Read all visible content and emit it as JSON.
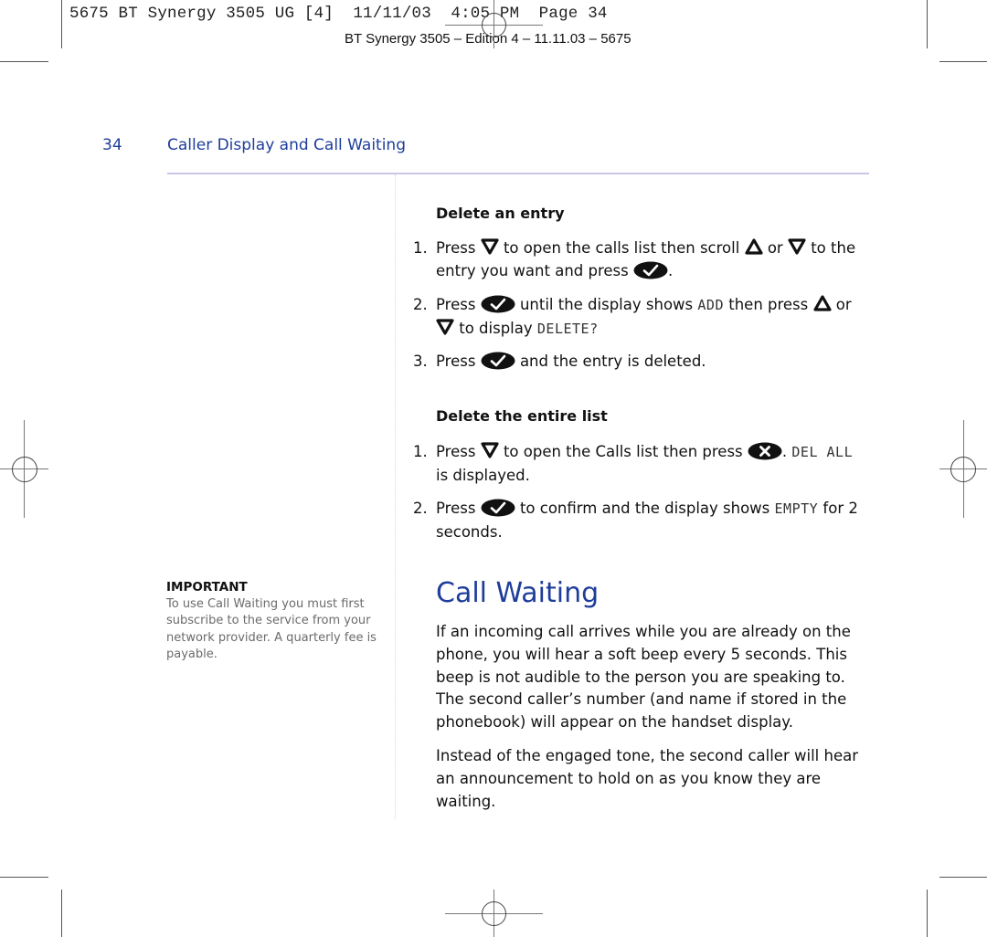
{
  "slug": {
    "text": "5675 BT Synergy 3505 UG [4]  11/11/03  4:05 PM  Page 34",
    "edition": "BT Synergy 3505 – Edition 4 – 11.11.03 – 5675"
  },
  "header": {
    "page_number": "34",
    "chapter_title": "Caller Display and Call Waiting"
  },
  "icons": {
    "down": "down-arrow-key-icon",
    "up": "up-arrow-key-icon",
    "ok": "ok-check-key-icon",
    "cancel": "cancel-x-key-icon"
  },
  "delete_entry": {
    "heading": "Delete an entry",
    "steps": [
      {
        "num": "1.",
        "t1": "Press",
        "t2": "to open the calls list then scroll",
        "t3": "or",
        "t4": "to the",
        "t5": "entry you want and press",
        "t6": "."
      },
      {
        "num": "2.",
        "t1": "Press",
        "t2": "until the display shows",
        "lcd1": "ADD",
        "t3": "then press",
        "t4": "or",
        "t5": "to display",
        "lcd2": "DELETE?"
      },
      {
        "num": "3.",
        "t1": "Press",
        "t2": "and the entry is deleted."
      }
    ]
  },
  "delete_list": {
    "heading": "Delete the entire list",
    "steps": [
      {
        "num": "1.",
        "t1": "Press",
        "t2": "to open the Calls list then press",
        "t3": ".",
        "lcd1": "DEL ALL",
        "t4": "is displayed."
      },
      {
        "num": "2.",
        "t1": "Press",
        "t2": "to confirm and the display shows",
        "lcd1": "EMPTY",
        "t3": "for 2",
        "t4": "seconds."
      }
    ]
  },
  "sidebar": {
    "important_title": "IMPORTANT",
    "important_body": "To use Call Waiting you must first subscribe to the service from your network provider. A quarterly fee is payable."
  },
  "call_waiting": {
    "title": "Call Waiting",
    "paragraphs": [
      "If an incoming call arrives while you are already on the phone, you will hear a soft beep every 5 seconds. This beep is not audible to the person you are speaking to. The second caller’s number (and name if stored in the phonebook) will appear on the handset display.",
      "Instead of the engaged tone, the second caller will hear an announcement to hold on as you know they are waiting."
    ]
  },
  "colors": {
    "accent_blue": "#1e3d9b",
    "rule_lavender": "#c8c6e6",
    "sidebar_text_gray": "#6b6b6b"
  }
}
